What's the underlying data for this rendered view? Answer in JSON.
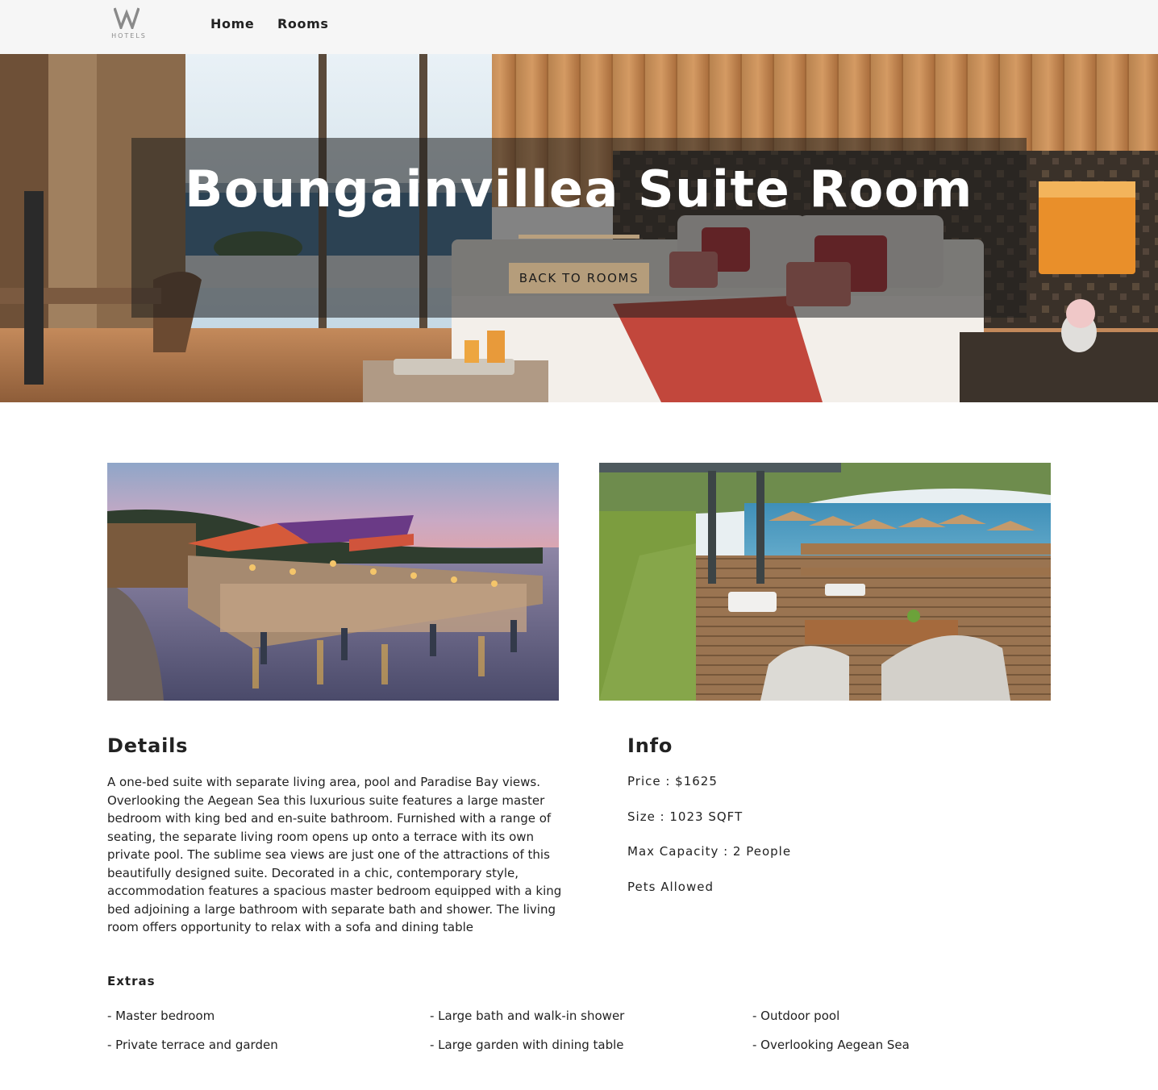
{
  "nav": {
    "logo_mark": "W",
    "logo_text": "HOTELS",
    "home_label": "Home",
    "rooms_label": "Rooms"
  },
  "hero": {
    "title": "Boungainvillea Suite Room",
    "button_label": "BACK TO ROOMS"
  },
  "details": {
    "title": "Details",
    "text": "A one-bed suite with separate living area, pool and Paradise Bay views. Overlooking the Aegean Sea this luxurious suite features a large master bedroom with king bed and en-suite bathroom. Furnished with a range of seating, the separate living room opens up onto a terrace with its own private pool. The sublime sea views are just one of the attractions of this beautifully designed suite. Decorated in a chic, contemporary style, accommodation features a spacious master bedroom equipped with a king bed adjoining a large bathroom with separate bath and shower. The living room offers opportunity to relax with a sofa and dining table"
  },
  "info": {
    "title": "Info",
    "price": "Price : $1625",
    "size": "Size : 1023 SQFT",
    "capacity": "Max Capacity : 2 People",
    "pets": "Pets Allowed"
  },
  "extras": {
    "title": "Extras",
    "items": [
      "- Master bedroom",
      "- Large bath and walk-in shower",
      "- Outdoor pool",
      "- Private terrace and garden",
      "- Large garden with dining table",
      "- Overlooking Aegean Sea"
    ]
  },
  "colors": {
    "accent": "#b59d7b",
    "navbar_bg": "#f6f6f6",
    "text": "#222222"
  }
}
